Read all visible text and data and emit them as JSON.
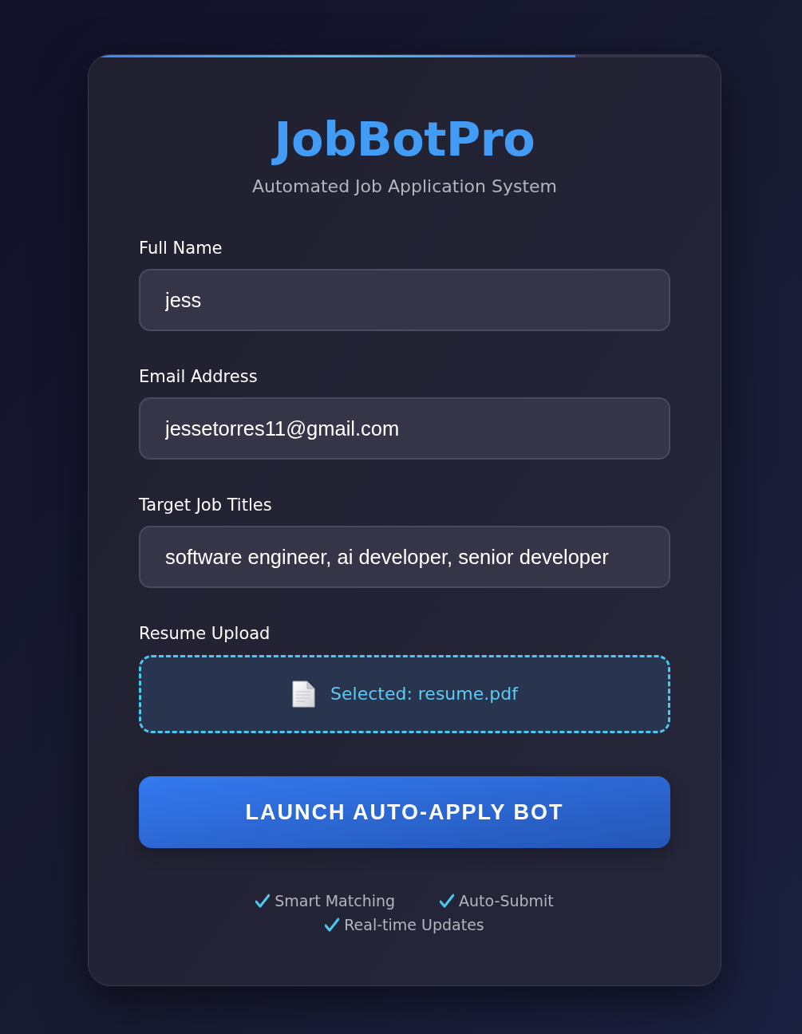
{
  "app": {
    "title": "JobBotPro",
    "subtitle": "Automated Job Application System"
  },
  "progress": {
    "level": 0.77
  },
  "fields": [
    {
      "label": "Full Name",
      "value": "jess"
    },
    {
      "label": "Email Address",
      "value": "jessetorres11@gmail.com"
    },
    {
      "label": "Target Job Titles",
      "value": "software engineer, ai developer, senior developer"
    }
  ],
  "upload": {
    "label": "Resume Upload",
    "status": "Selected: resume.pdf"
  },
  "submit_button": {
    "label": "LAUNCH AUTO-APPLY BOT"
  },
  "features": [
    "Smart Matching",
    "Auto-Submit",
    "Real-time Updates"
  ]
}
